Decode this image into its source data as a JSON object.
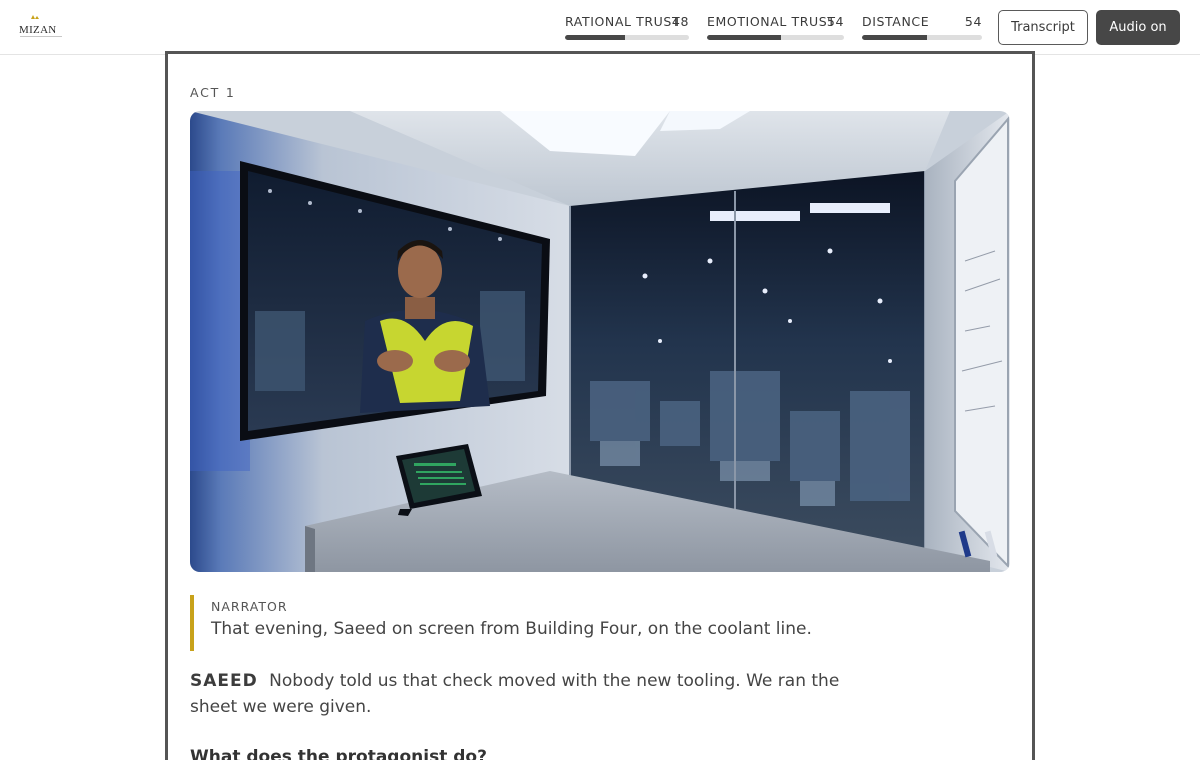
{
  "brand": {
    "logo_text": "MIZAN"
  },
  "header": {
    "meters": [
      {
        "label": "RATIONAL TRUST",
        "value": "48",
        "level": 48
      },
      {
        "label": "EMOTIONAL TRUST",
        "value": "54",
        "level": 54
      },
      {
        "label": "DISTANCE",
        "value": "54",
        "level": 54
      }
    ],
    "transcript_label": "Transcript",
    "audio_label": "Audio on"
  },
  "story": {
    "act_label": "ACT 1",
    "narrator": {
      "tag": "NARRATOR",
      "text": "That evening, Saeed on screen from Building Four, on the coolant line."
    },
    "dialogue": {
      "speaker": "SAEED",
      "text": "Nobody told us that check moved with the new tooling. We ran the sheet we were given."
    },
    "prompt": "What does the protagonist do?"
  },
  "colors": {
    "accent": "#c8a21a",
    "meter_fill": "#484848",
    "meter_track": "#dedede",
    "button_dark": "#474747",
    "border": "#555555"
  }
}
